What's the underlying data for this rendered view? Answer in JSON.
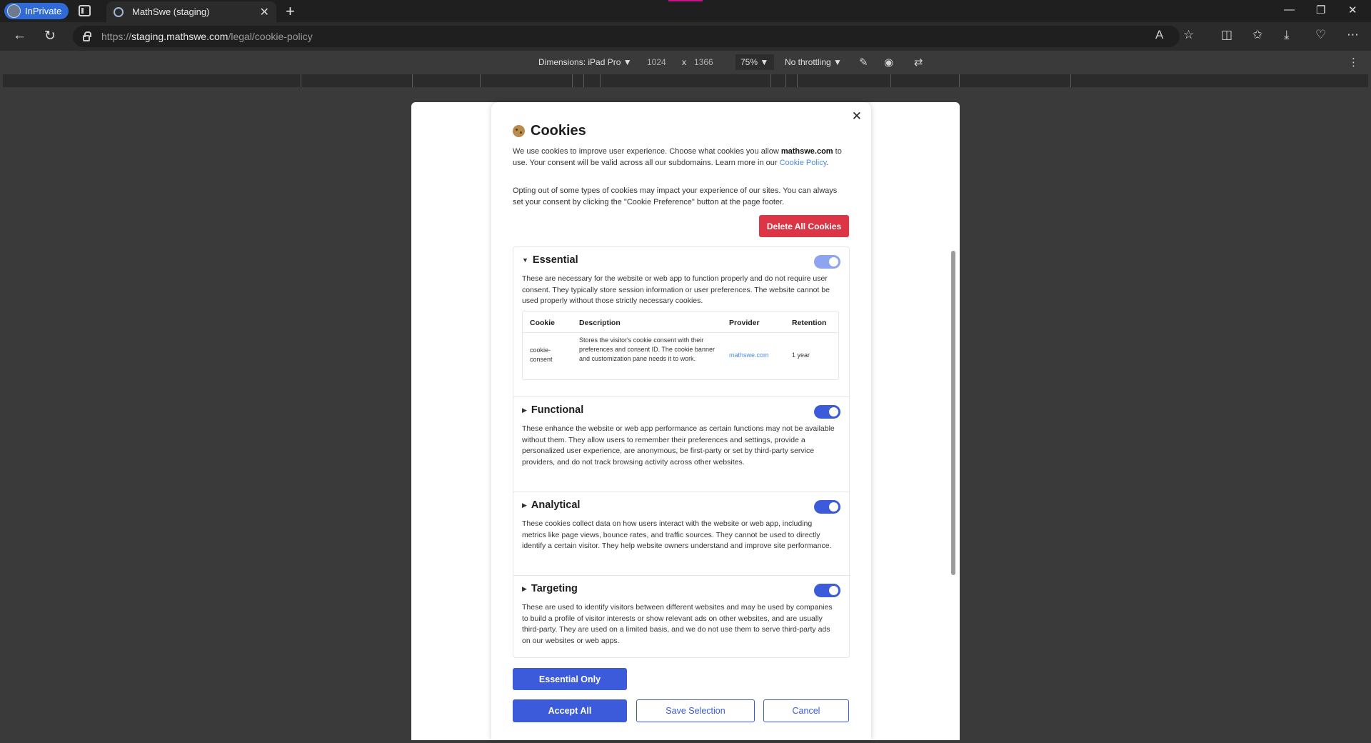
{
  "browser": {
    "profile_label": "InPrivate",
    "tab_title": "MathSwe (staging)",
    "tab_close": "✕",
    "new_tab": "+",
    "url_scheme": "https://",
    "url_host": "staging.mathswe.com",
    "url_path": "/legal/cookie-policy"
  },
  "devtools": {
    "dimensions_label": "Dimensions: iPad Pro ▼",
    "width": "1024",
    "times": "x",
    "height": "1366",
    "zoom": "75% ▼",
    "throttling": "No throttling ▼"
  },
  "modal": {
    "close": "✕",
    "title": "Cookies",
    "intro_p1_a": "We use cookies to improve user experience. Choose what cookies you allow ",
    "intro_p1_site": "mathswe.com",
    "intro_p1_b": " to use. Your consent will be valid across all our subdomains. Learn more in our ",
    "intro_p1_link": "Cookie Policy",
    "intro_p1_c": ".",
    "intro_p2": "Opting out of some types of cookies may impact your experience of our sites. You can always set your consent by clicking the \"Cookie Preference\" button at the page footer.",
    "delete_button": "Delete All Cookies",
    "sections": [
      {
        "title": "Essential",
        "caret": "▼",
        "enabled": true,
        "locked": true,
        "description": "These are necessary for the website or web app to function properly and do not require user consent. They typically store session information or user preferences. The website cannot be used properly without those strictly necessary cookies."
      },
      {
        "title": "Functional",
        "caret": "▶",
        "enabled": true,
        "locked": false,
        "description": "These enhance the website or web app performance as certain functions may not be available without them. They allow users to remember their preferences and settings, provide a personalized user experience, are anonymous, be first-party or set by third-party service providers, and do not track browsing activity across other websites."
      },
      {
        "title": "Analytical",
        "caret": "▶",
        "enabled": true,
        "locked": false,
        "description": "These cookies collect data on how users interact with the website or web app, including metrics like page views, bounce rates, and traffic sources. They cannot be used to directly identify a certain visitor. They help website owners understand and improve site performance."
      },
      {
        "title": "Targeting",
        "caret": "▶",
        "enabled": true,
        "locked": false,
        "description": "These are used to identify visitors between different websites and may be used by companies to build a profile of visitor interests or show relevant ads on other websites, and are usually third-party. They are used on a limited basis, and we do not use them to serve third-party ads on our websites or web apps."
      }
    ],
    "cookie_table": {
      "headers": [
        "Cookie",
        "Description",
        "Provider",
        "Retention"
      ],
      "rows": [
        {
          "cookie": "cookie-consent",
          "description": "Stores the visitor's cookie consent with their preferences and consent ID. The cookie banner and customization pane needs it to work.",
          "provider": "mathswe.com",
          "retention": "1 year"
        }
      ]
    },
    "buttons": {
      "essential_only": "Essential Only",
      "accept_all": "Accept All",
      "save_selection": "Save Selection",
      "cancel": "Cancel"
    }
  },
  "colors": {
    "primary": "#3b5bdb",
    "danger": "#dc3545",
    "link": "#4a8de8",
    "inprivate": "#2f6ad6"
  }
}
